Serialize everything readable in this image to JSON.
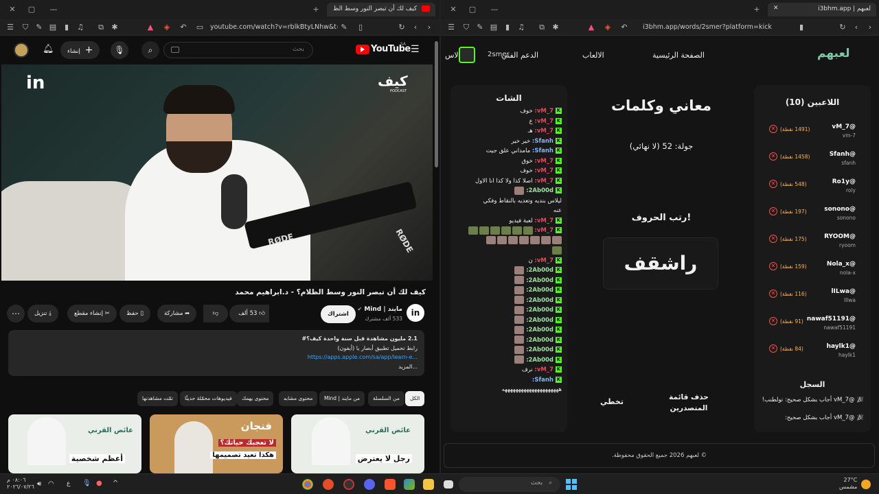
{
  "left_window": {
    "tab_title": "كيف لك أن تبصر النور وسط الظ",
    "url": "youtube.com/watch?v=rblkBtyLNhw&t=1...",
    "youtube": {
      "logo_text": "YouTube",
      "region": "SA",
      "search_placeholder": "بحث",
      "create_label": "إنشاء",
      "video_brand_top": "كيف",
      "video_brand_sub": "PODCAST",
      "mic_brand_1": "RØDE",
      "mic_brand_2": "RØDE",
      "title": "كيف لك أن تبصر النور وسط الظلام؟ - د.ابراهيم محمد",
      "channel_name": "مايند | Mind",
      "subscribers": "533 ألف مشترك",
      "subscribe_label": "اشتراك",
      "likes": "53 ألف",
      "share_label": "مشاركة",
      "save_label": "حفظ",
      "clip_label": "إنشاء مقطع",
      "download_label": "تنزيل",
      "description": {
        "stats": "2.1 مليون مشاهدة  قبل سنة واحدة  كيف؟#",
        "line2": "رابط تحميل تطبيق أبصار يا (أيفون)",
        "link": "https://apps.apple.com/sa/app/learn-e...",
        "more": "...المزيد"
      },
      "chips": [
        "الكل",
        "من السلسلة",
        "من مايند | Mind",
        "محتوى مشابه",
        "محتوى يهمك",
        "فيديوهات محمّلة حديثًا",
        "تمّت مشاهدتها"
      ],
      "thumbs": [
        {
          "text1": "رجل لا يعترض",
          "text2": "عائض القرني"
        },
        {
          "text1": "لا تعجبك حياتك؟",
          "text2": "هكذا تعيد تصميمها",
          "brand": "فنجان"
        },
        {
          "text1": "أعظم شخصية",
          "text2": "عائض القرني"
        }
      ]
    }
  },
  "right_window": {
    "tab_title": "لعبهم | i3bhm.app",
    "url": "i3bhm.app/words/2smer?platform=kick",
    "logo": "لعبهم",
    "nav": {
      "home": "الصفحة الرئيسية",
      "games": "الالعاب",
      "support": "الدعم الفني",
      "user": "2smer",
      "cut": "الاس"
    },
    "players_title": "اللاعبين (10)",
    "players": [
      {
        "name": "@vM_7",
        "handle": "vm-7",
        "points": "(1491 نقطة)"
      },
      {
        "name": "@Sfanh",
        "handle": "sfanh",
        "points": "(1458 نقطة)"
      },
      {
        "name": "@Ro1y",
        "handle": "roly",
        "points": "(548 نقطة)"
      },
      {
        "name": "@sonono",
        "handle": "sonono",
        "points": "(197 نقطة)"
      },
      {
        "name": "@RYOOM",
        "handle": "ryoom",
        "points": "(175 نقطة)"
      },
      {
        "name": "@Nola_x",
        "handle": "nola-x",
        "points": "(159 نقطة)"
      },
      {
        "name": "@lILwa",
        "handle": "lllwa",
        "points": "(116 نقطة)"
      },
      {
        "name": "@nawaf51191",
        "handle": "nawaf51191",
        "points": "(91 نقطة)"
      },
      {
        "name": "@haylk1",
        "handle": "haylk1",
        "points": "(84 نقطة)"
      }
    ],
    "log_title": "السجل",
    "log": [
      "@vM_7 أجاب بشكل صحيح: تولطنب!",
      "@vM_7 أجاب بشكل صحيح:"
    ],
    "game_title": "معاني وكلمات",
    "round": "جولة: 52 (لا نهائي)",
    "instruction": "رتب الحروف!",
    "scrambled": "راشقف",
    "clear_leaderboard": "حذف قائمة المتصدرين",
    "skip": "تخطي",
    "chat_title": "الشات",
    "chat": [
      {
        "user": "vM_7:",
        "cls": "vm",
        "text": "خوف"
      },
      {
        "user": "vM_7:",
        "cls": "vm",
        "text": "ع"
      },
      {
        "user": "vM_7:",
        "cls": "vm",
        "text": "هـ"
      },
      {
        "user": "Sfanh:",
        "cls": "sf",
        "text": "خير خير"
      },
      {
        "user": "Sfanh:",
        "cls": "sf",
        "text": "مامداني علق جيت"
      },
      {
        "user": "vM_7:",
        "cls": "vm",
        "text": "خوق"
      },
      {
        "user": "vM_7:",
        "cls": "vm",
        "text": "خوف"
      },
      {
        "user": "vM_7:",
        "cls": "vm",
        "text": "اصلا كذا ولا كذا انا الاول"
      },
      {
        "user": "2Ab00d:",
        "cls": "ab",
        "text": ""
      },
      {
        "user": "",
        "cls": "",
        "text": "ليلاس بنديه وتعديه بالنقاط وفكي"
      },
      {
        "user": "",
        "cls": "",
        "text": "عنه"
      },
      {
        "user": "vM_7:",
        "cls": "vm",
        "text": "لعبة فيديو"
      },
      {
        "user": "vM_7:",
        "cls": "vm",
        "text": ""
      },
      {
        "user": "",
        "cls": "",
        "text": ""
      },
      {
        "user": "",
        "cls": "",
        "text": ""
      },
      {
        "user": "vM_7:",
        "cls": "vm",
        "text": "ن"
      },
      {
        "user": "2Ab00d:",
        "cls": "ab",
        "text": ""
      },
      {
        "user": "2Ab00d:",
        "cls": "ab",
        "text": ""
      },
      {
        "user": "2Ab00d:",
        "cls": "ab",
        "text": ""
      },
      {
        "user": "2Ab00d:",
        "cls": "ab",
        "text": ""
      },
      {
        "user": "2Ab00d:",
        "cls": "ab",
        "text": ""
      },
      {
        "user": "2Ab00d:",
        "cls": "ab",
        "text": ""
      },
      {
        "user": "2Ab00d:",
        "cls": "ab",
        "text": ""
      },
      {
        "user": "2Ab00d:",
        "cls": "ab",
        "text": ""
      },
      {
        "user": "2Ab00d:",
        "cls": "ab",
        "text": ""
      },
      {
        "user": "2Ab00d:",
        "cls": "ab",
        "text": ""
      },
      {
        "user": "vM_7:",
        "cls": "vm",
        "text": "نرف"
      },
      {
        "user": "Sfanh:",
        "cls": "sf",
        "text": ""
      },
      {
        "user": "",
        "cls": "",
        "text": "هههههههههههههههههههههه"
      }
    ],
    "footer": "© لعبهم 2026 جميع الحقوق محفوظة."
  },
  "taskbar": {
    "search_placeholder": "بحث",
    "weather_temp": "27°C",
    "weather_desc": "مشمس",
    "time": "٠٨:٠٦ م",
    "date": "٢٠٢٦/٠٧/٢٦",
    "lang": "ع"
  },
  "colors": {
    "kick_green": "#53fc18",
    "youtube_red": "#ff0000",
    "remove_red": "#ff4d4d",
    "points_orange": "#ffb84d"
  }
}
